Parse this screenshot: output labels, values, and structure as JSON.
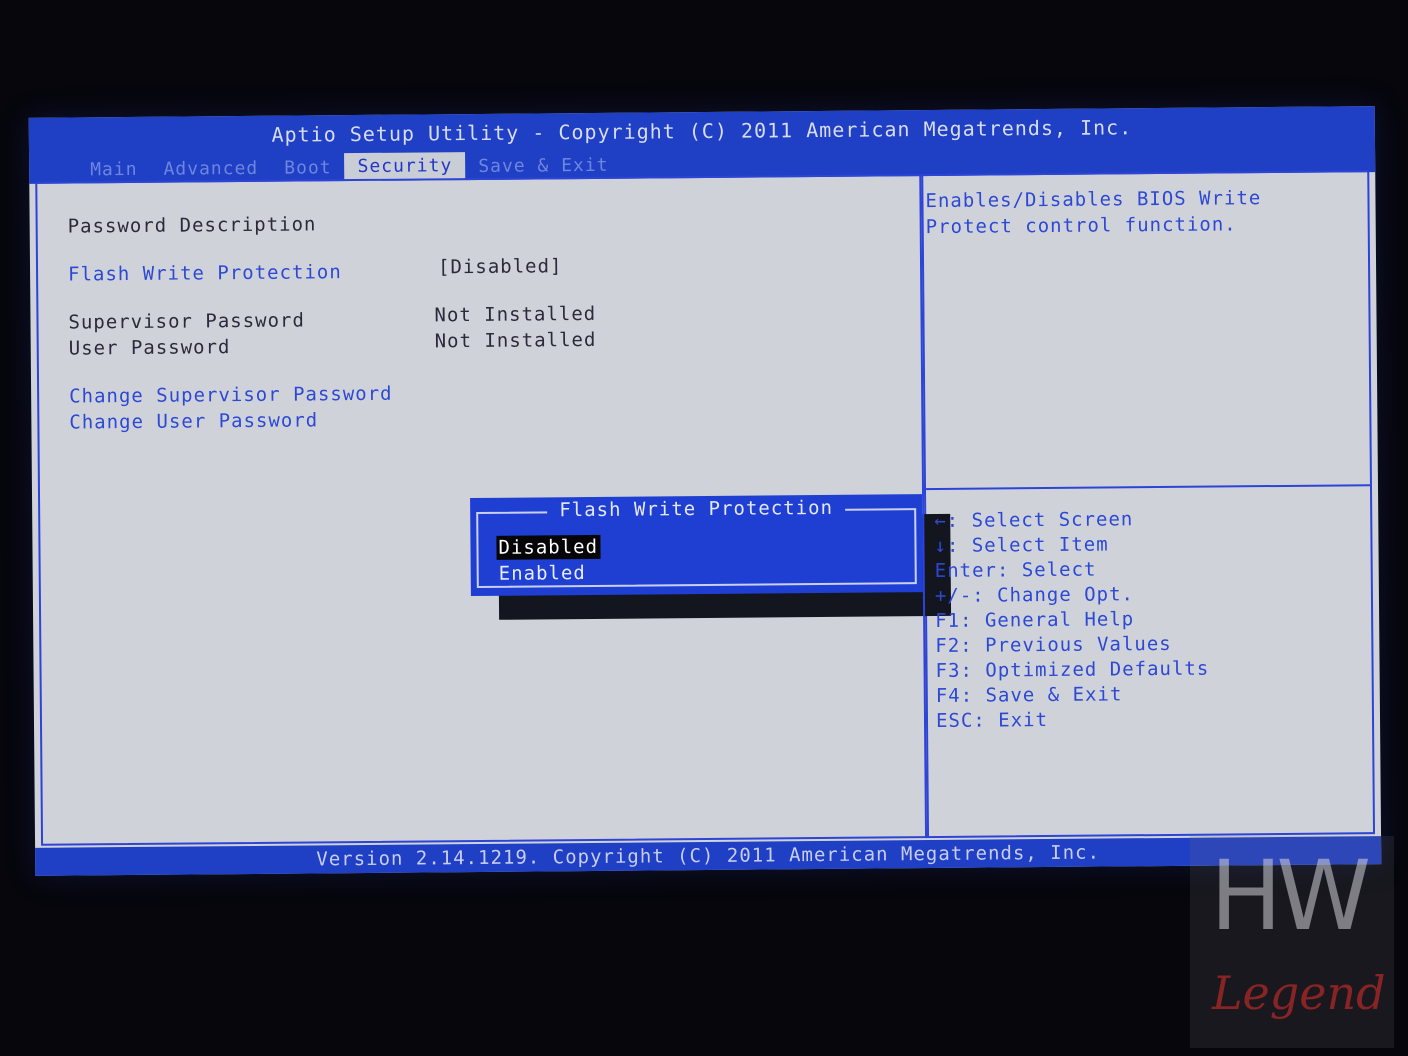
{
  "header": {
    "title": "Aptio Setup Utility - Copyright (C) 2011 American Megatrends, Inc.",
    "tabs": [
      {
        "label": "Main"
      },
      {
        "label": "Advanced"
      },
      {
        "label": "Boot"
      },
      {
        "label": "Security",
        "active": true
      },
      {
        "label": "Save & Exit"
      }
    ]
  },
  "main": {
    "section_title": "Password Description",
    "flash_write_protection": {
      "label": "Flash Write Protection",
      "value": "[Disabled]"
    },
    "supervisor_password": {
      "label": "Supervisor Password",
      "value": "Not Installed"
    },
    "user_password": {
      "label": "User Password",
      "value": "Not Installed"
    },
    "change_supervisor": "Change Supervisor Password",
    "change_user": "Change User Password"
  },
  "popup": {
    "title": "Flash Write Protection",
    "options": [
      "Disabled",
      "Enabled"
    ],
    "selected": "Disabled"
  },
  "help": {
    "description_line1": "Enables/Disables BIOS Write",
    "description_line2": "Protect control function.",
    "keys": [
      "←: Select Screen",
      "↓: Select Item",
      "Enter: Select",
      "+/-: Change Opt.",
      "F1: General Help",
      "F2: Previous Values",
      "F3: Optimized Defaults",
      "F4: Save & Exit",
      "ESC: Exit"
    ]
  },
  "footer": {
    "version": "Version 2.14.1219. Copyright (C) 2011 American Megatrends, Inc."
  },
  "watermark": {
    "line1": "HW",
    "line2": "Legend"
  },
  "colors": {
    "bios_blue": "#1f3fc4",
    "panel_gray": "#cfd3d9",
    "highlight_blue": "#2c48d4"
  }
}
